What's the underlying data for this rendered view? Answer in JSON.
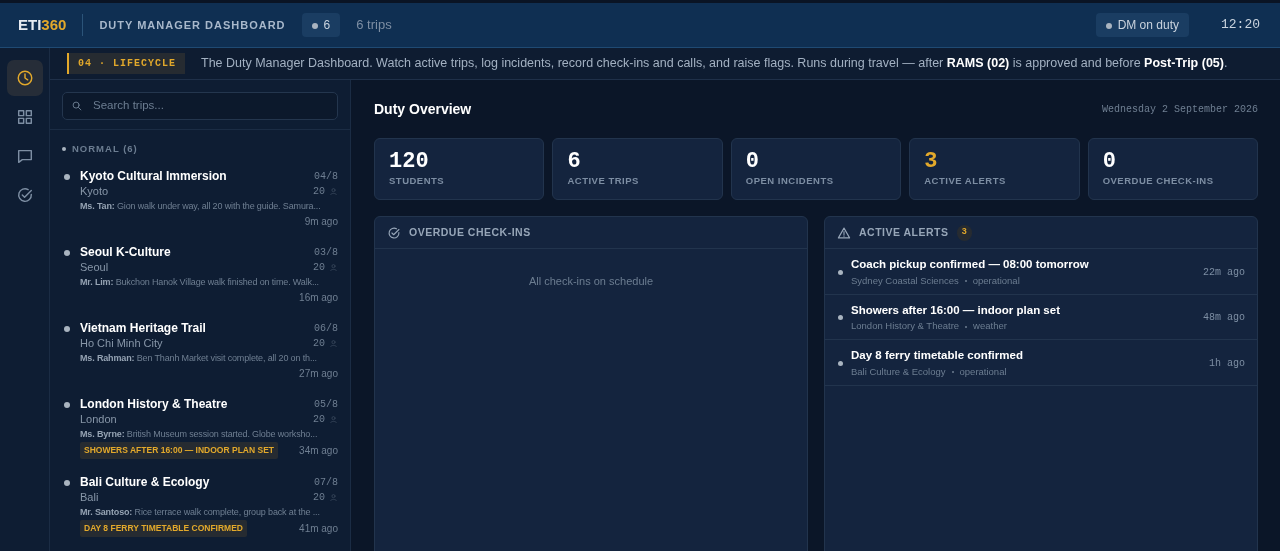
{
  "header": {
    "logo_main": "ETI",
    "logo_accent": "360",
    "title": "DUTY MANAGER DASHBOARD",
    "count_pill": "6",
    "trips_label": "6 trips",
    "status_pill": "DM on duty",
    "time": "12:20"
  },
  "rail": [
    {
      "kind": "clock",
      "selected": true
    },
    {
      "kind": "grid",
      "selected": false
    },
    {
      "kind": "chat",
      "selected": false
    },
    {
      "kind": "check",
      "selected": false
    }
  ],
  "banner": {
    "tag": "04 · LIFECYCLE",
    "text": "The Duty Manager Dashboard. Watch active trips, log incidents, record check-ins and calls, and raise flags. Runs during travel — after **RAMS (02)** is approved and before **Post-Trip (05)**."
  },
  "trip_list": {
    "search_placeholder": "Search trips...",
    "group": "NORMAL (6)",
    "trips": [
      {
        "name": "Kyoto Cultural Immersion",
        "city": "Kyoto",
        "day": "04/8",
        "students": "20",
        "speaker": "Ms. Tan:",
        "note": "Gion walk under way, all 20 with the guide. Samura...",
        "time": "9m ago"
      },
      {
        "name": "Seoul K-Culture",
        "city": "Seoul",
        "day": "03/8",
        "students": "20",
        "speaker": "Mr. Lim:",
        "note": "Bukchon Hanok Village walk finished on time. Walk...",
        "time": "16m ago"
      },
      {
        "name": "Vietnam Heritage Trail",
        "city": "Ho Chi Minh City",
        "day": "06/8",
        "students": "20",
        "speaker": "Ms. Rahman:",
        "note": "Ben Thanh Market visit complete, all 20 on th...",
        "time": "27m ago"
      },
      {
        "name": "London History & Theatre",
        "city": "London",
        "day": "05/8",
        "students": "20",
        "speaker": "Ms. Byrne:",
        "note": "British Museum session started. Globe worksho...",
        "tag": "SHOWERS AFTER 16:00 — INDOOR PLAN SET",
        "time": "34m ago"
      },
      {
        "name": "Bali Culture & Ecology",
        "city": "Bali",
        "day": "07/8",
        "students": "20",
        "speaker": "Mr. Santoso:",
        "note": "Rice terrace walk complete, group back at the ...",
        "tag": "DAY 8 FERRY TIMETABLE CONFIRMED",
        "time": "41m ago"
      }
    ]
  },
  "overview": {
    "title": "Duty Overview",
    "date": "Wednesday 2 September 2026",
    "stats": [
      {
        "value": "120",
        "label": "STUDENTS",
        "highlight": false
      },
      {
        "value": "6",
        "label": "ACTIVE TRIPS",
        "highlight": false
      },
      {
        "value": "0",
        "label": "OPEN INCIDENTS",
        "highlight": false
      },
      {
        "value": "3",
        "label": "ACTIVE ALERTS",
        "highlight": true
      },
      {
        "value": "0",
        "label": "OVERDUE CHECK-INS",
        "highlight": false
      }
    ],
    "checkins": {
      "title": "OVERDUE CHECK-INS",
      "empty": "All check-ins on schedule"
    },
    "alerts": {
      "title": "ACTIVE ALERTS",
      "count": "3",
      "items": [
        {
          "title": "Coach pickup confirmed — 08:00 tomorrow",
          "trip": "Sydney Coastal Sciences",
          "category": "operational",
          "time": "22m ago"
        },
        {
          "title": "Showers after 16:00 — indoor plan set",
          "trip": "London History & Theatre",
          "category": "weather",
          "time": "48m ago"
        },
        {
          "title": "Day 8 ferry timetable confirmed",
          "trip": "Bali Culture & Ecology",
          "category": "operational",
          "time": "1h ago"
        }
      ]
    }
  }
}
